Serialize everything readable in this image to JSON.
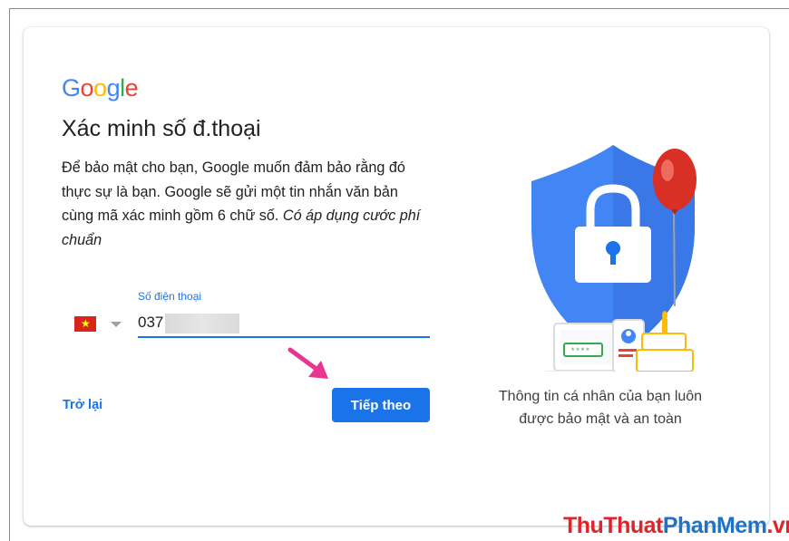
{
  "logo": {
    "letters": [
      "G",
      "o",
      "o",
      "g",
      "l",
      "e"
    ],
    "colors": [
      "#4285F4",
      "#EA4335",
      "#FBBC05",
      "#4285F4",
      "#34A853",
      "#EA4335"
    ]
  },
  "page": {
    "title": "Xác minh số đ.thoại",
    "description": "Để bảo mật cho bạn, Google muốn đảm bảo rằng đó thực sự là bạn. Google sẽ gửi một tin nhắn văn bản cùng mã xác minh gồm 6 chữ số.",
    "description_italic": "Có áp dụng cước phí chuẩn"
  },
  "phone": {
    "label": "Số điện thoại",
    "value": "037",
    "country_flag": "vietnam-flag-icon"
  },
  "actions": {
    "back_label": "Trở lại",
    "next_label": "Tiếp theo"
  },
  "illustration": {
    "masked_code": "****",
    "caption": "Thông tin cá nhân của bạn luôn được bảo mật và an toàn"
  },
  "watermark": {
    "part1": "ThuThuat",
    "part2": "PhanMem",
    "part3": ".vn"
  },
  "colors": {
    "accent": "#1a73e8",
    "shield": "#4285f4",
    "balloon": "#d93025",
    "annotation_arrow": "#e8358f"
  }
}
